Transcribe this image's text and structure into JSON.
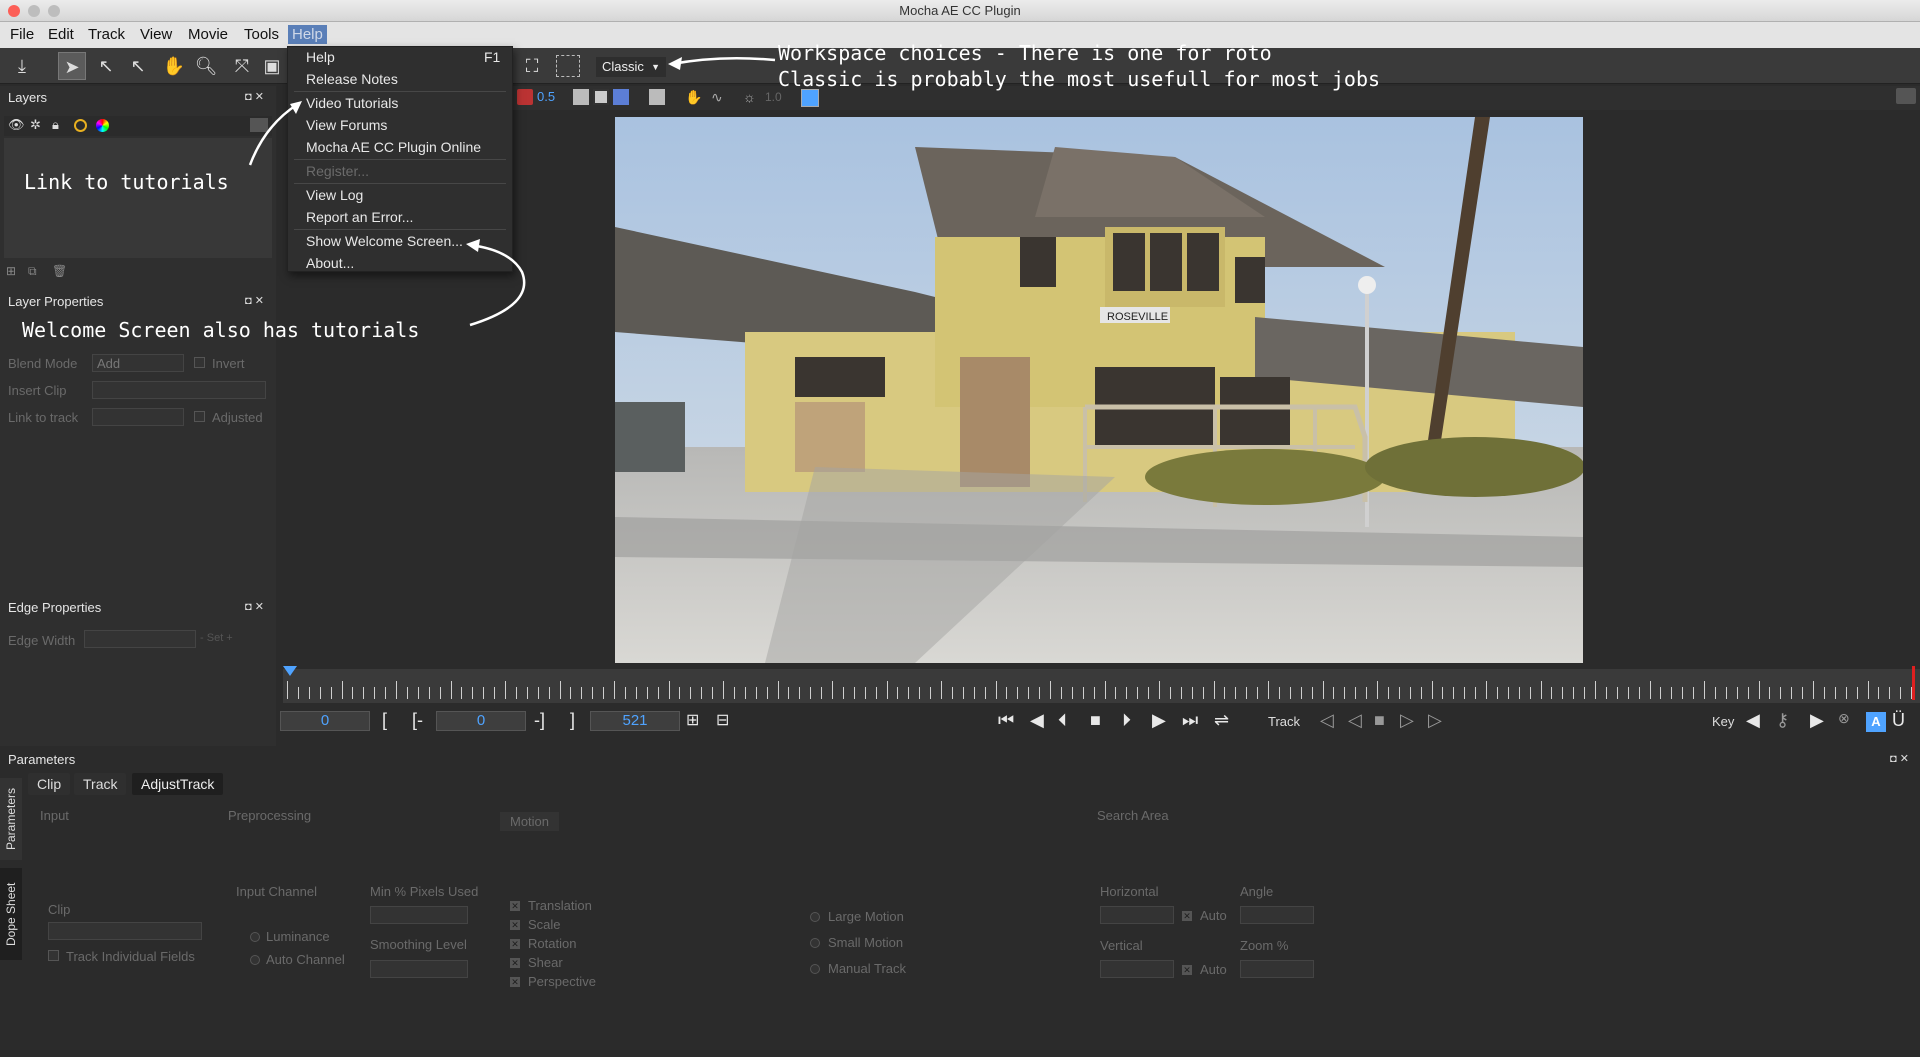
{
  "window": {
    "title": "Mocha AE CC Plugin"
  },
  "menubar": {
    "items": [
      "File",
      "Edit",
      "Track",
      "View",
      "Movie",
      "Tools",
      "Help"
    ]
  },
  "help_menu": {
    "items": [
      {
        "label": "Help",
        "shortcut": "F1"
      },
      {
        "label": "Release Notes"
      },
      {
        "label": "Video Tutorials"
      },
      {
        "label": "View Forums"
      },
      {
        "label": "Mocha AE CC Plugin Online"
      },
      {
        "label": "Register...",
        "disabled": true
      },
      {
        "label": "View Log"
      },
      {
        "label": "Report an Error..."
      },
      {
        "label": "Show Welcome Screen..."
      },
      {
        "label": "About..."
      }
    ]
  },
  "toolbar": {
    "workspace": "Classic",
    "zoom_value": "0.5",
    "gamma_value": "1.0"
  },
  "annotations": {
    "workspace": "Workspace choices - There is one for roto\nClassic is probably the most usefull for most jobs",
    "tutorials": "Link to tutorials",
    "welcome": "Welcome Screen also has tutorials"
  },
  "layers_panel": {
    "title": "Layers"
  },
  "layer_properties": {
    "title": "Layer Properties",
    "blend_mode_label": "Blend Mode",
    "blend_mode_value": "Add",
    "invert_label": "Invert",
    "insert_clip_label": "Insert Clip",
    "link_to_track_label": "Link to track",
    "adjusted_label": "Adjusted"
  },
  "edge_properties": {
    "title": "Edge Properties",
    "edge_width_label": "Edge Width",
    "set_label": "Set"
  },
  "viewer": {
    "sign_text": "ROSEVILLE"
  },
  "transport": {
    "in_frame": "0",
    "current_frame": "0",
    "out_frame": "521",
    "track_label": "Track",
    "key_label": "Key"
  },
  "parameters": {
    "title": "Parameters",
    "side_tabs": [
      "Parameters",
      "Dope Sheet"
    ],
    "tabs": [
      "Clip",
      "Track",
      "AdjustTrack"
    ],
    "active_tab": "AdjustTrack",
    "sections": {
      "input": "Input",
      "preprocessing": "Preprocessing",
      "motion": "Motion",
      "search_area": "Search Area"
    },
    "clip_label": "Clip",
    "track_fields_label": "Track Individual Fields",
    "input_channel_label": "Input Channel",
    "luminance_label": "Luminance",
    "auto_channel_label": "Auto Channel",
    "min_pixels_label": "Min % Pixels Used",
    "smoothing_label": "Smoothing Level",
    "motion_options": [
      "Translation",
      "Scale",
      "Rotation",
      "Shear",
      "Perspective"
    ],
    "motion_modes": [
      "Large Motion",
      "Small Motion",
      "Manual Track"
    ],
    "horizontal_label": "Horizontal",
    "vertical_label": "Vertical",
    "angle_label": "Angle",
    "zoom_label": "Zoom %",
    "auto_label": "Auto"
  },
  "colors": {
    "menu_highlight": "#5a7fb8",
    "frame_blue": "#4fa3ff",
    "playhead_red": "#e02020"
  }
}
